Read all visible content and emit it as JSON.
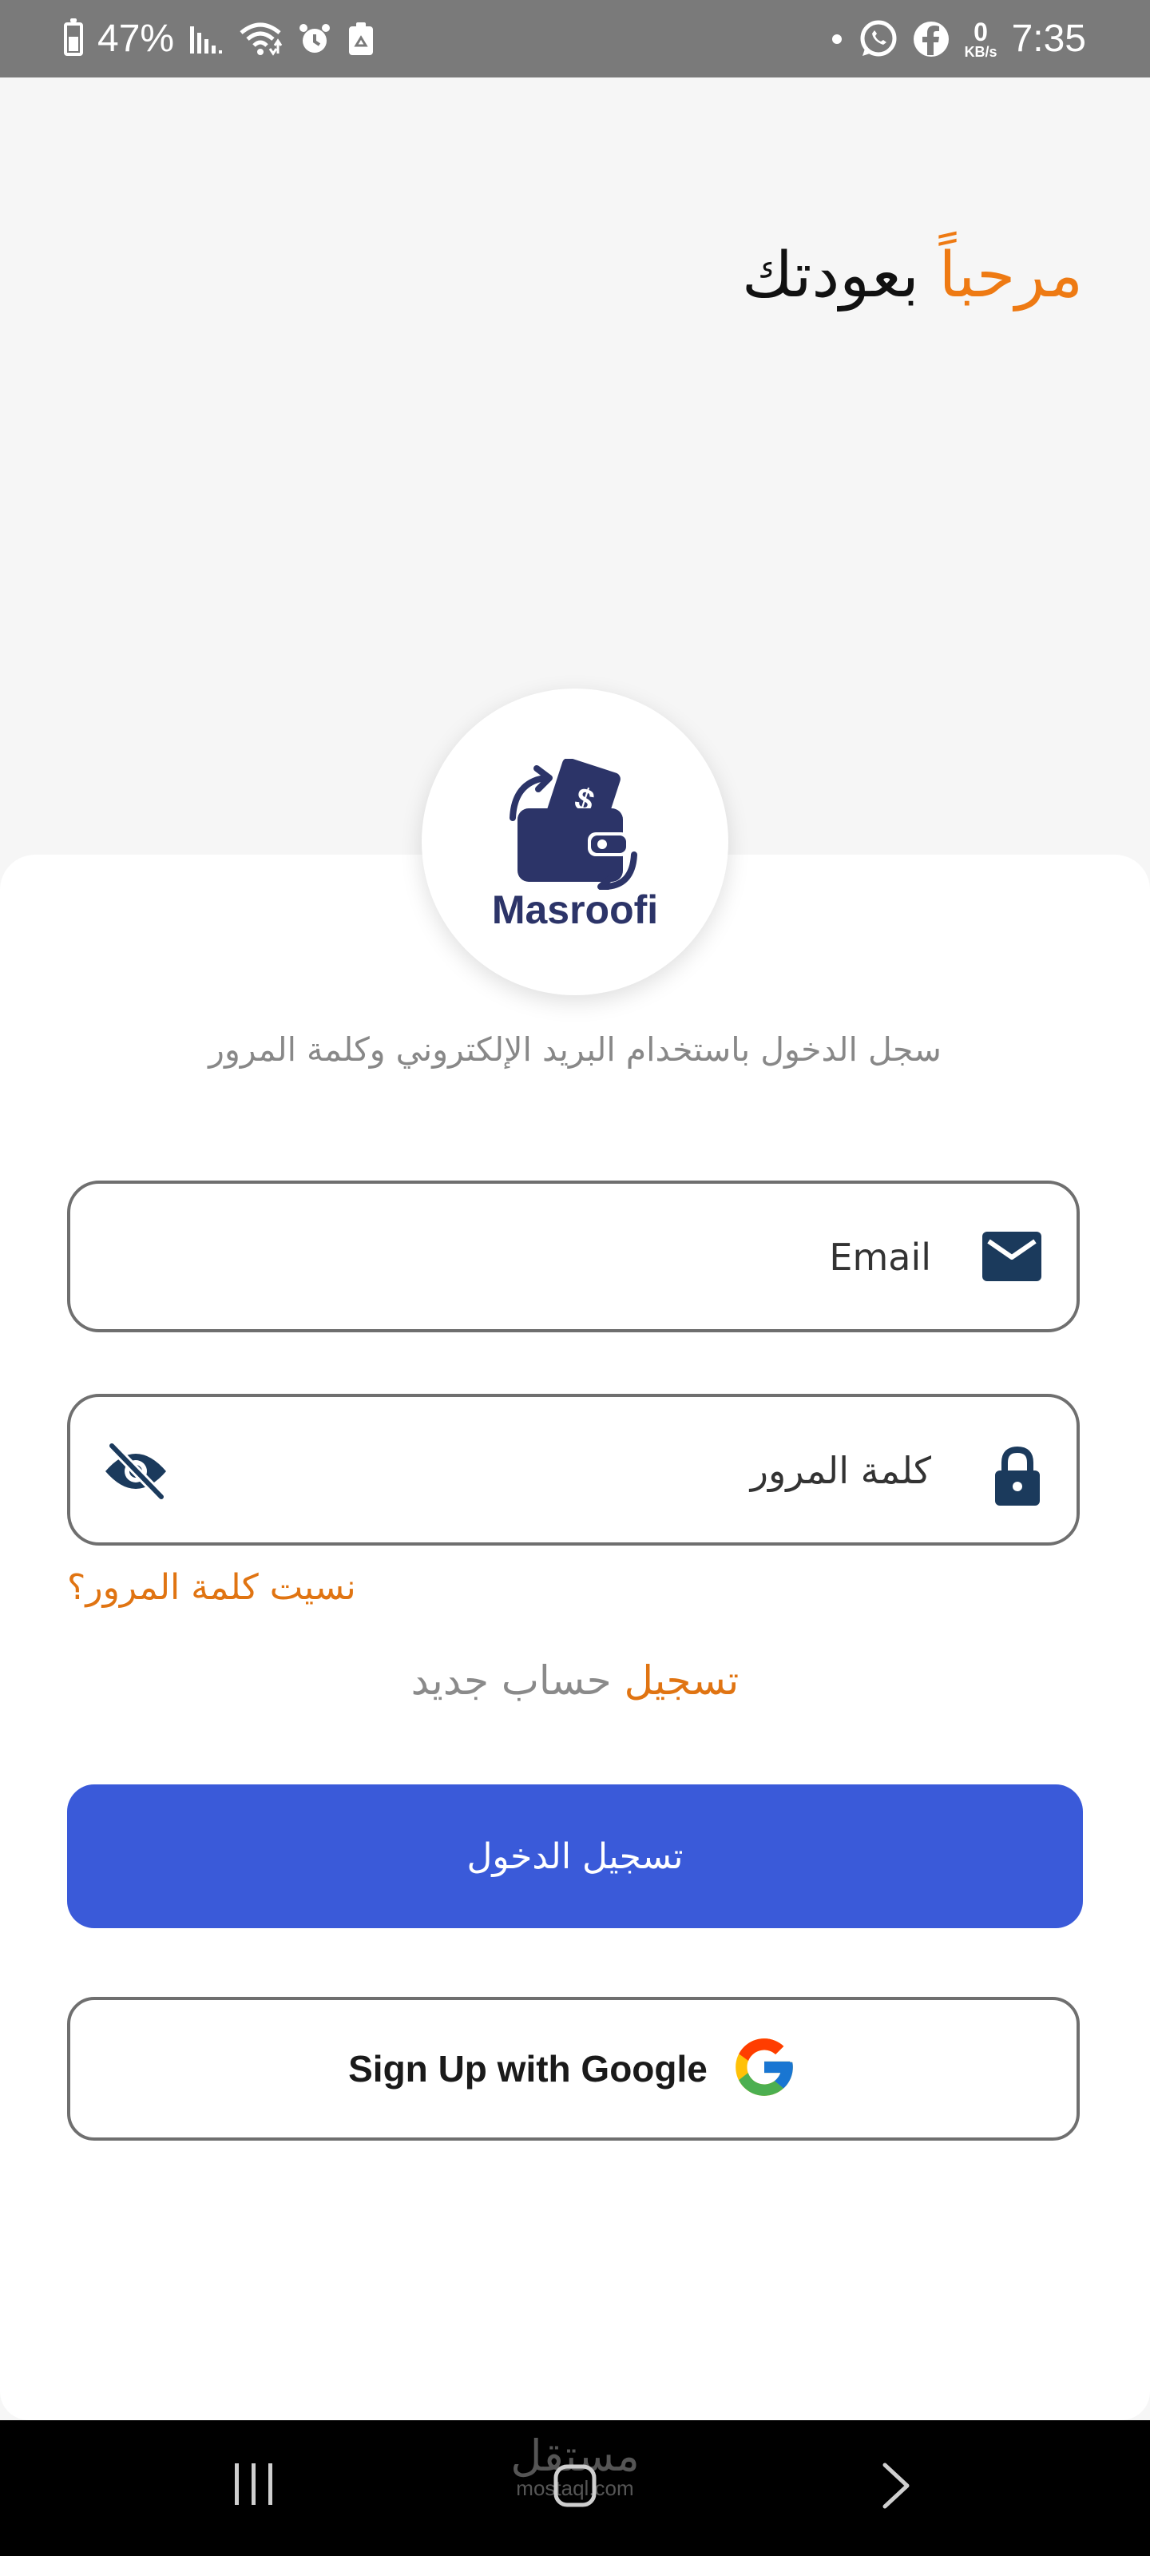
{
  "status_bar": {
    "battery": "47%",
    "time": "7:35",
    "net_speed_value": "0",
    "net_speed_unit": "KB/s",
    "icons": [
      "battery-icon",
      "signal-icon",
      "wifi-icon",
      "alarm-icon",
      "recycle-icon",
      "dot-icon",
      "whatsapp-icon",
      "facebook-icon"
    ]
  },
  "header": {
    "welcome_highlight": "مرحباً",
    "welcome_rest": "بعودتك"
  },
  "logo": {
    "text": "Masroofi",
    "icon": "wallet-icon"
  },
  "form": {
    "subtitle": "سجل الدخول باستخدام البريد الإلكتروني وكلمة المرور",
    "email_placeholder": "Email",
    "email_value": "",
    "password_placeholder": "كلمة المرور",
    "password_value": "",
    "forgot_password": "نسيت كلمة المرور؟",
    "register_link": "تسجيل",
    "register_text": "حساب جديد",
    "login_button": "تسجيل الدخول",
    "google_button": "Sign Up with Google"
  },
  "colors": {
    "accent_orange": "#ee7a13",
    "primary_blue": "#3a5ad9",
    "icon_navy": "#1b3a5c",
    "logo_navy": "#2c3468"
  },
  "nav_bar": {
    "watermark_ar": "مستقل",
    "watermark_en": "mostaql.com",
    "icons": [
      "recents-icon",
      "home-icon",
      "back-icon"
    ]
  }
}
